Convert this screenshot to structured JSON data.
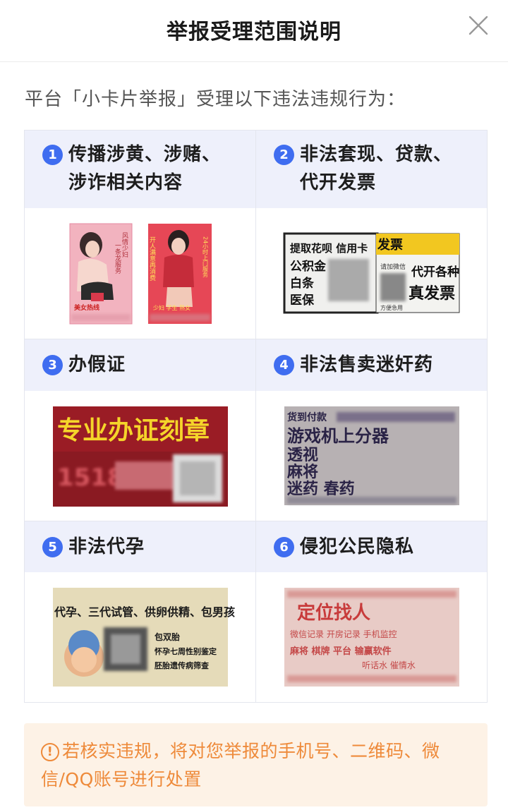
{
  "header": {
    "title": "举报受理范围说明",
    "close_icon": "close-icon"
  },
  "intro": "平台「小卡片举报」受理以下违法违规行为：",
  "categories": [
    {
      "num": "1",
      "line1": "传播涉黄、涉赌、",
      "line2": "涉诈相关内容"
    },
    {
      "num": "2",
      "line1": "非法套现、贷款、",
      "line2": "代开发票"
    },
    {
      "num": "3",
      "line1": "办假证"
    },
    {
      "num": "4",
      "line1": "非法售卖迷奸药"
    },
    {
      "num": "5",
      "line1": "非法代孕"
    },
    {
      "num": "6",
      "line1": "侵犯公民隐私"
    }
  ],
  "cards": {
    "c1a": {
      "t1": "风情少妇",
      "t2": "一条龙服务",
      "t3": "美女热线"
    },
    "c1b": {
      "t1": "开人满意再消费",
      "t2": "24小时上门服务",
      "t3": "少妇 学生 熟女"
    },
    "c2a": {
      "l1": "提取花呗 信用卡",
      "l2": "公积金",
      "l3": "白条",
      "l4": "医保"
    },
    "c2b": {
      "l1": "发票",
      "l2": "请加微信",
      "l3": "代开各种",
      "l4": "真发票",
      "l5": "方便急用"
    },
    "c3": {
      "title": "专业办证刻章",
      "num": "1518"
    },
    "c4": {
      "l1": "货到付款",
      "l2": "游戏机上分器",
      "l3": "透视",
      "l4": "麻将",
      "l5": "迷药   春药"
    },
    "c5": {
      "l1": "代孕、三代试管、供卵供精、包男孩",
      "l2": "包双胎",
      "l3": "怀孕七周性别鉴定",
      "l4": "胚胎遗传病筛查"
    },
    "c6": {
      "l1": "定位找人",
      "l2": "微信记录 开房记录 手机监控",
      "l3": "麻将 棋牌 平台 输赢软件",
      "l4": "听话水 催情水"
    }
  },
  "notice": {
    "text": "若核实违规，将对您举报的手机号、二维码、微信/QQ账号进行处置",
    "icon": "warning-icon"
  },
  "colors": {
    "accent": "#3f6df0",
    "header_bg": "#eef0fb",
    "notice_bg": "#fdf2e6",
    "notice_text": "#ee8a3a"
  }
}
